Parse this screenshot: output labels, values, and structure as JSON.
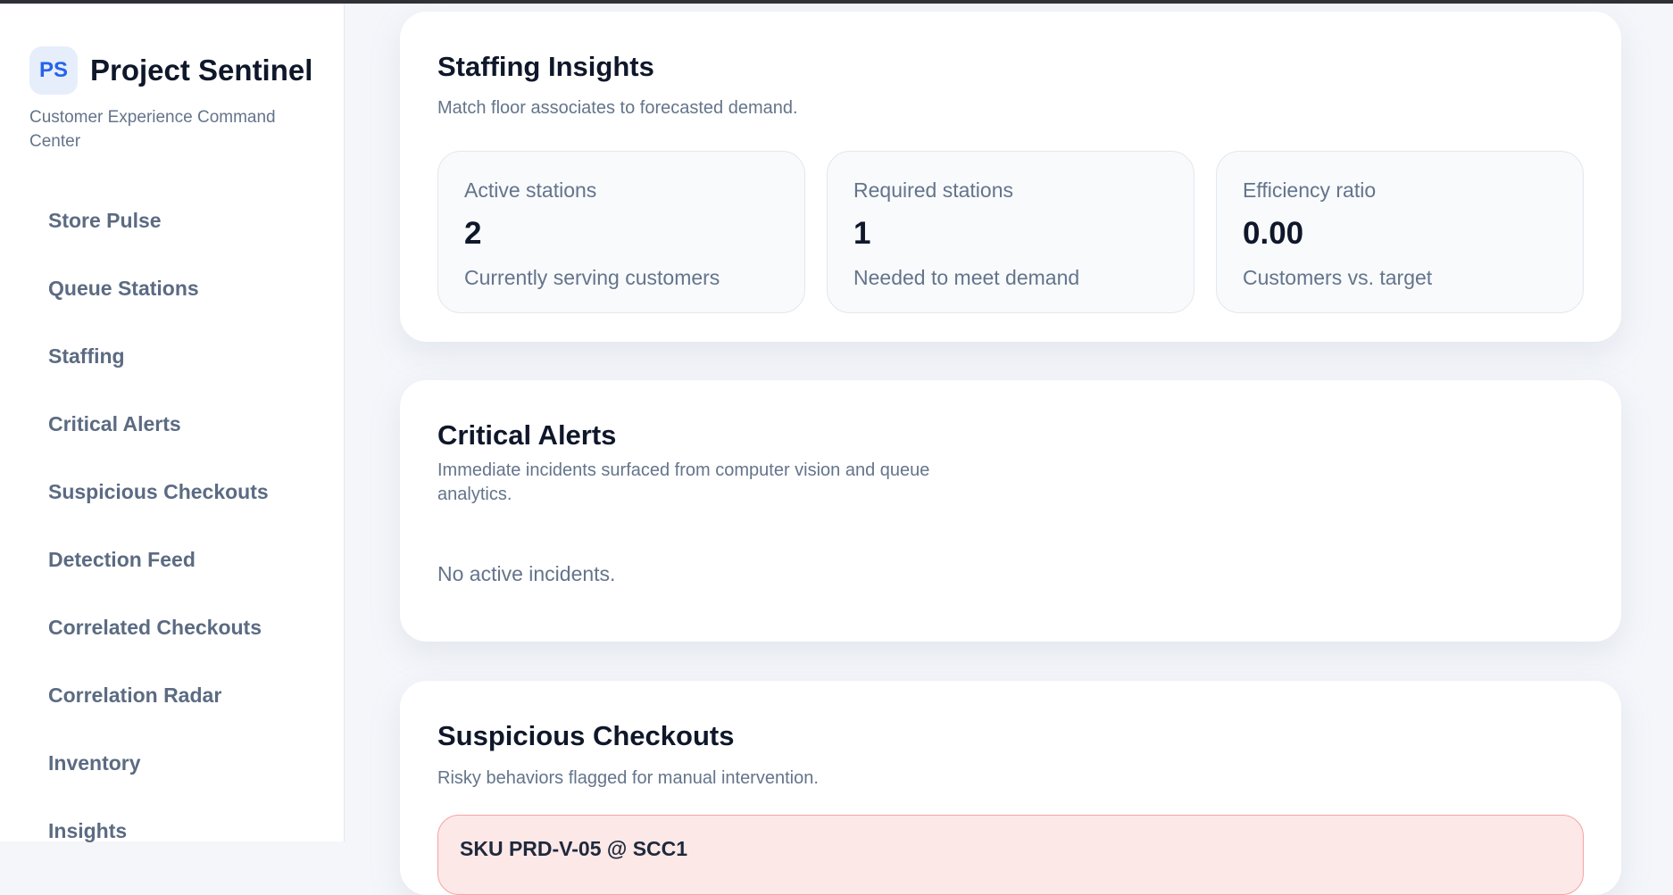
{
  "sidebar": {
    "brand_initials": "PS",
    "brand_name": "Project Sentinel",
    "brand_subtitle": "Customer Experience Command Center",
    "items": [
      {
        "label": "Store Pulse"
      },
      {
        "label": "Queue Stations"
      },
      {
        "label": "Staffing"
      },
      {
        "label": "Critical Alerts"
      },
      {
        "label": "Suspicious Checkouts"
      },
      {
        "label": "Detection Feed"
      },
      {
        "label": "Correlated Checkouts"
      },
      {
        "label": "Correlation Radar"
      },
      {
        "label": "Inventory"
      },
      {
        "label": "Insights"
      }
    ]
  },
  "staffing": {
    "title": "Staffing Insights",
    "subtitle": "Match floor associates to forecasted demand.",
    "stats": [
      {
        "label": "Active stations",
        "value": "2",
        "note": "Currently serving customers"
      },
      {
        "label": "Required stations",
        "value": "1",
        "note": "Needed to meet demand"
      },
      {
        "label": "Efficiency ratio",
        "value": "0.00",
        "note": "Customers vs. target"
      }
    ]
  },
  "alerts": {
    "title": "Critical Alerts",
    "subtitle": "Immediate incidents surfaced from computer vision and queue analytics.",
    "empty": "No active incidents."
  },
  "suspicious": {
    "title": "Suspicious Checkouts",
    "subtitle": "Risky behaviors flagged for manual intervention.",
    "first_item": "SKU PRD-V-05 @ SCC1"
  },
  "colors": {
    "accent": "#2563eb",
    "alert_bg": "#fde8e8",
    "alert_border": "#f5a3a3"
  }
}
